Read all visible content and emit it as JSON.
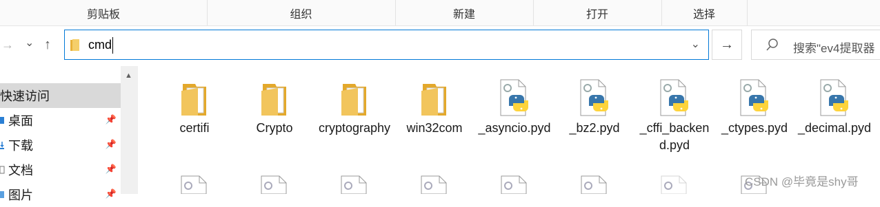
{
  "ribbon": {
    "groups": [
      "剪贴板",
      "组织",
      "新建",
      "打开",
      "选择"
    ]
  },
  "nav_buttons": {
    "forward": "→",
    "recent": "⌄",
    "up": "↑"
  },
  "address_bar": {
    "value": "cmd",
    "dropdown": "⌄"
  },
  "go_button": "→",
  "search": {
    "placeholder": "搜索\"ev4提取器"
  },
  "nav_pane": {
    "items": [
      {
        "label": "快速访问",
        "selected": true,
        "pinned": false
      },
      {
        "label": "桌面",
        "selected": false,
        "pinned": true
      },
      {
        "label": "下载",
        "selected": false,
        "pinned": true
      },
      {
        "label": "文档",
        "selected": false,
        "pinned": true
      },
      {
        "label": "图片",
        "selected": false,
        "pinned": true
      }
    ]
  },
  "files": [
    {
      "name": "certifi",
      "type": "folder"
    },
    {
      "name": "Crypto",
      "type": "folder"
    },
    {
      "name": "cryptography",
      "type": "folder"
    },
    {
      "name": "win32com",
      "type": "folder"
    },
    {
      "name": "_asyncio.pyd",
      "type": "pyd"
    },
    {
      "name": "_bz2.pyd",
      "type": "pyd"
    },
    {
      "name": "_cffi_backend.pyd",
      "type": "pyd"
    },
    {
      "name": "_ctypes.pyd",
      "type": "pyd"
    },
    {
      "name": "_decimal.pyd",
      "type": "pyd"
    }
  ],
  "watermark": "CSDN @毕竟是shy哥",
  "colors": {
    "accent": "#0078d7",
    "selection": "#d9d9d9",
    "folder": "#f2c55c",
    "python_blue": "#3776ab",
    "python_yellow": "#ffd43b"
  }
}
